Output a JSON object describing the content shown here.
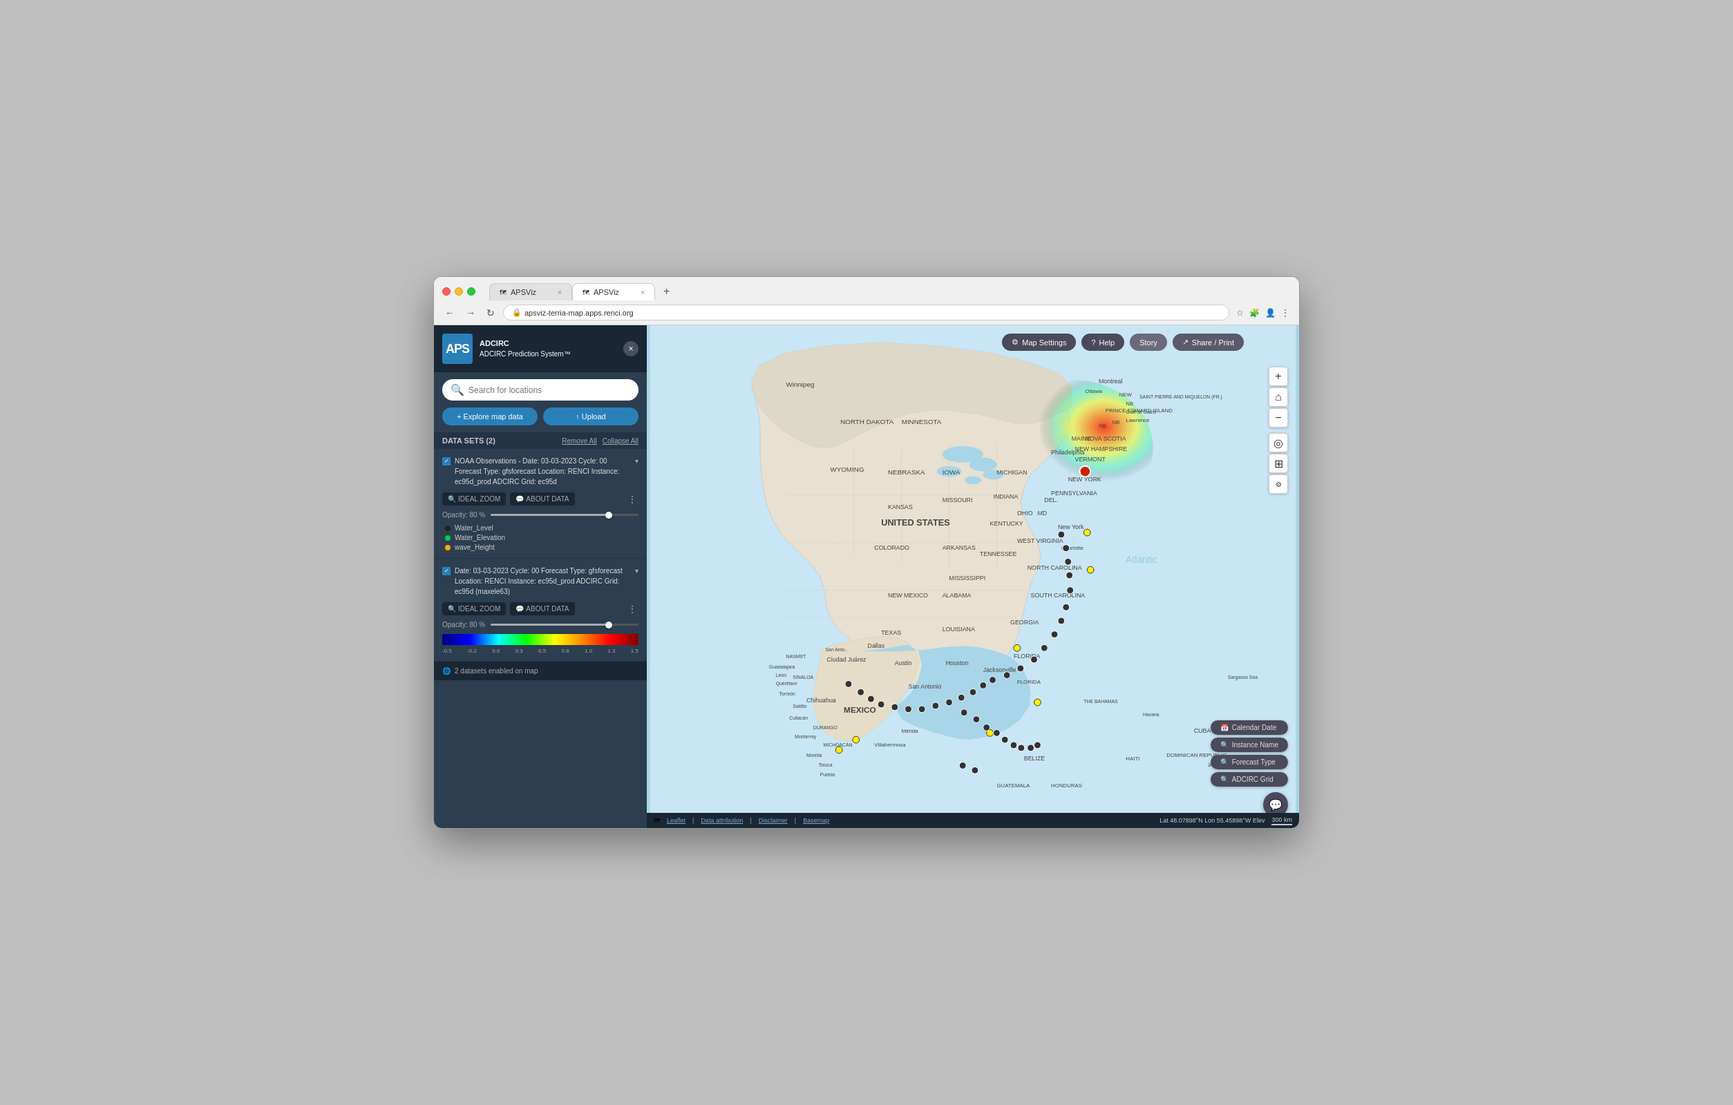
{
  "browser": {
    "tabs": [
      {
        "id": "tab1",
        "label": "APSViz",
        "active": false,
        "favicon": "🗺"
      },
      {
        "id": "tab2",
        "label": "APSViz",
        "active": true,
        "favicon": "🗺"
      }
    ],
    "address": "apsviz-terria-map.apps.renci.org",
    "new_tab_label": "+"
  },
  "app": {
    "logo": "APS",
    "logo_title": "ADCIRC Prediction System™",
    "close_btn": "×"
  },
  "sidebar": {
    "search_placeholder": "Search for locations",
    "explore_label": "+ Explore map data",
    "upload_label": "↑ Upload",
    "datasets_label": "DATA SETS (2)",
    "remove_all_label": "Remove All",
    "collapse_all_label": "Collapse All",
    "datasets": [
      {
        "id": "ds1",
        "title": "NOAA Observations - Date: 03-03-2023 Cycle: 00 Forecast Type: gfsforecast Location: RENCI Instance: ec95d_prod ADCIRC Grid: ec95d",
        "ideal_zoom": "IDEAL ZOOM",
        "about_data": "ABOUT DATA",
        "opacity_label": "Opacity: 80 %",
        "legend": [
          {
            "label": "Water_Level",
            "color": "#222"
          },
          {
            "label": "Water_Elevation",
            "color": "#00cc44"
          },
          {
            "label": "wave_Height",
            "color": "#ffaa00"
          }
        ]
      },
      {
        "id": "ds2",
        "title": "Date: 03-03-2023 Cycle: 00 Forecast Type: gfsforecast Location: RENCI Instance: ec95d_prod ADCIRC Grid: ec95d (maxele63)",
        "ideal_zoom": "IDEAL ZOOM",
        "about_data": "ABOUT DATA",
        "opacity_label": "Opacity: 80 %",
        "colorbar_labels": [
          "-0.5",
          "-0.2",
          "0.0",
          "0.3",
          "0.5",
          "0.8",
          "1.0",
          "1.3",
          "1.5"
        ]
      }
    ],
    "map_count": "2 datasets enabled on map"
  },
  "toolbar": {
    "map_settings": "Map Settings",
    "help": "Help",
    "story": "Story",
    "share": "Share / Print"
  },
  "zoom_controls": {
    "plus": "+",
    "home": "⌂",
    "minus": "−",
    "location": "◎",
    "layers": "⊞",
    "settings": "⚙"
  },
  "filters": {
    "calendar_date": "Calendar Date",
    "instance_name": "Instance Name",
    "forecast_type": "Forecast Type",
    "adcirc_grid": "ADCIRC Grid"
  },
  "map_status": {
    "leaflet": "Leaflet",
    "data_attribution": "Data attribution",
    "disclaimer": "Disclaimer",
    "basemap": "Basemap",
    "coords": "Lat 48.07898°N  Lon 55.45898°W  Elev",
    "scale": "300 km"
  },
  "water_level_label": "Water Level"
}
